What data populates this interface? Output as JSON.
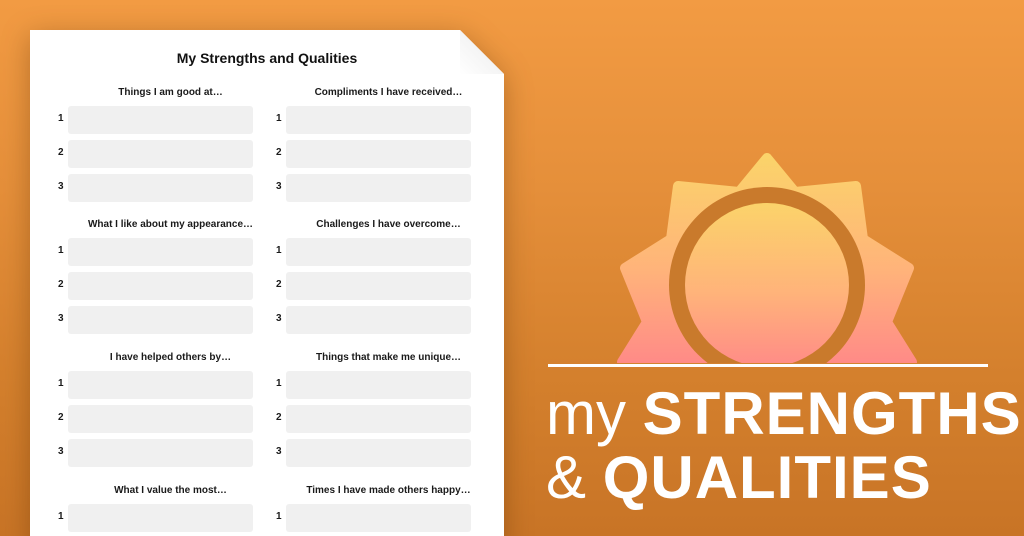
{
  "worksheet": {
    "title": "My Strengths and Qualities",
    "sections": [
      {
        "heading": "Things I am good at…",
        "numbers": [
          "1",
          "2",
          "3"
        ]
      },
      {
        "heading": "Compliments I have received…",
        "numbers": [
          "1",
          "2",
          "3"
        ]
      },
      {
        "heading": "What I like about my appearance…",
        "numbers": [
          "1",
          "2",
          "3"
        ]
      },
      {
        "heading": "Challenges I have overcome…",
        "numbers": [
          "1",
          "2",
          "3"
        ]
      },
      {
        "heading": "I have helped others by…",
        "numbers": [
          "1",
          "2",
          "3"
        ]
      },
      {
        "heading": "Things that make me unique…",
        "numbers": [
          "1",
          "2",
          "3"
        ]
      },
      {
        "heading": "What I value the most…",
        "numbers": [
          "1"
        ]
      },
      {
        "heading": "Times I have made others happy…",
        "numbers": [
          "1"
        ]
      }
    ]
  },
  "branding": {
    "line1_light": "my",
    "line1_bold": "STRENGTHS",
    "line2_light": "&",
    "line2_bold": "QUALITIES",
    "icon": "sun-icon",
    "colors": {
      "background": "#e5903a",
      "sun_top": "#fbd36a",
      "sun_bottom": "#ff8b87",
      "text": "#ffffff"
    }
  }
}
